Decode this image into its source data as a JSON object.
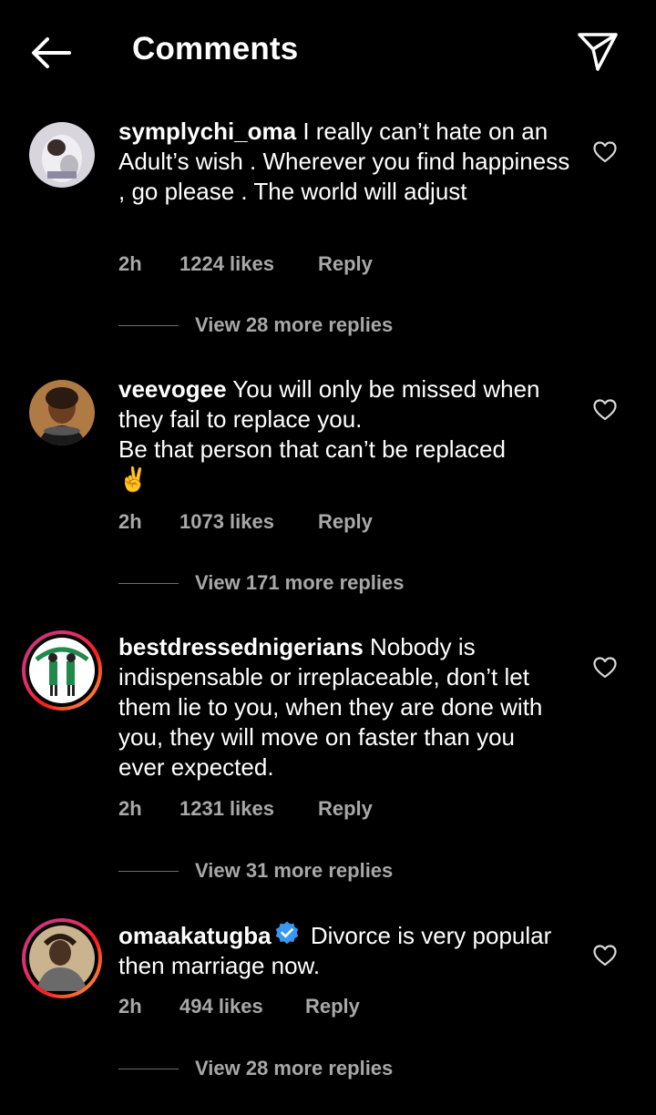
{
  "header": {
    "title": "Comments",
    "back_icon": "back-arrow-icon",
    "send_icon": "paper-plane-icon"
  },
  "comments": [
    {
      "username": "symplychi_oma",
      "text": " I really can’t hate on an Adult’s wish . Wherever you find happiness , go please . The world will adjust",
      "time": "2h",
      "likes": "1224 likes",
      "reply": "Reply",
      "view_replies": "View 28 more replies"
    },
    {
      "username": "veevogee",
      "text": " You will only be missed when they fail to replace you.",
      "text2": "Be that person that can’t be replaced",
      "emoji": "✌️",
      "time": "2h",
      "likes": "1073 likes",
      "reply": "Reply",
      "view_replies": "View 171 more replies"
    },
    {
      "username": "bestdressednigerians",
      "text": " Nobody is indispensable or irreplaceable, don’t let them lie to you, when they are done with you, they will move on faster than you ever expected.",
      "time": "2h",
      "likes": "1231 likes",
      "reply": "Reply",
      "view_replies": "View 31 more replies"
    },
    {
      "username": "omaakatugba",
      "text": " Divorce is very popular then marriage now.",
      "time": "2h",
      "likes": "494 likes",
      "reply": "Reply",
      "view_replies": "View 28 more replies"
    }
  ],
  "colors": {
    "background": "#000000",
    "primary_text": "#ffffff",
    "secondary_text": "#a8a8a8",
    "verified_blue": "#3897f0"
  }
}
